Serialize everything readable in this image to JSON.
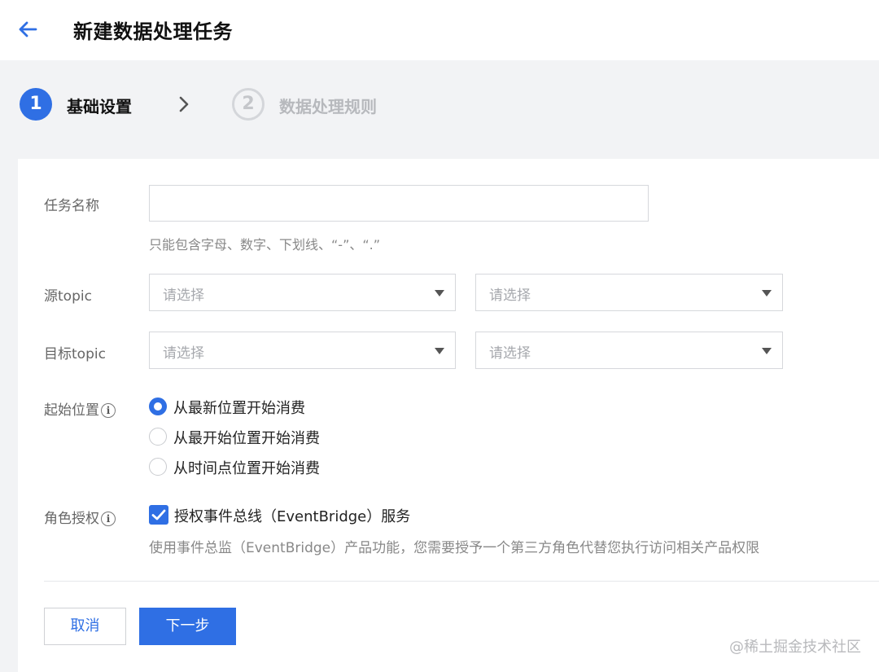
{
  "header": {
    "back_icon": "arrow-left-icon",
    "title": "新建数据处理任务"
  },
  "steps": [
    {
      "number": "1",
      "label": "基础设置",
      "state": "active"
    },
    {
      "number": "2",
      "label": "数据处理规则",
      "state": "inactive"
    }
  ],
  "form": {
    "task_name": {
      "label": "任务名称",
      "value": "",
      "placeholder": "",
      "hint": "只能包含字母、数字、下划线、“-”、“.”"
    },
    "source_topic": {
      "label": "源topic",
      "select1_placeholder": "请选择",
      "select2_placeholder": "请选择"
    },
    "target_topic": {
      "label": "目标topic",
      "select1_placeholder": "请选择",
      "select2_placeholder": "请选择"
    },
    "start_position": {
      "label": "起始位置",
      "info_icon": "info-icon",
      "options": [
        "从最新位置开始消费",
        "从最开始位置开始消费",
        "从时间点位置开始消费"
      ],
      "selected": "从最新位置开始消费"
    },
    "role_auth": {
      "label": "角色授权",
      "info_icon": "info-icon",
      "checkbox_label": "授权事件总线（EventBridge）服务",
      "checked": true,
      "description": "使用事件总监（EventBridge）产品功能，您需要授予一个第三方角色代替您执行访问相关产品权限"
    }
  },
  "buttons": {
    "cancel": "取消",
    "next": "下一步"
  },
  "watermark": "@稀土掘金技术社区",
  "colors": {
    "accent": "#2f6fe4",
    "background": "#f2f3f5",
    "panel": "#ffffff"
  }
}
